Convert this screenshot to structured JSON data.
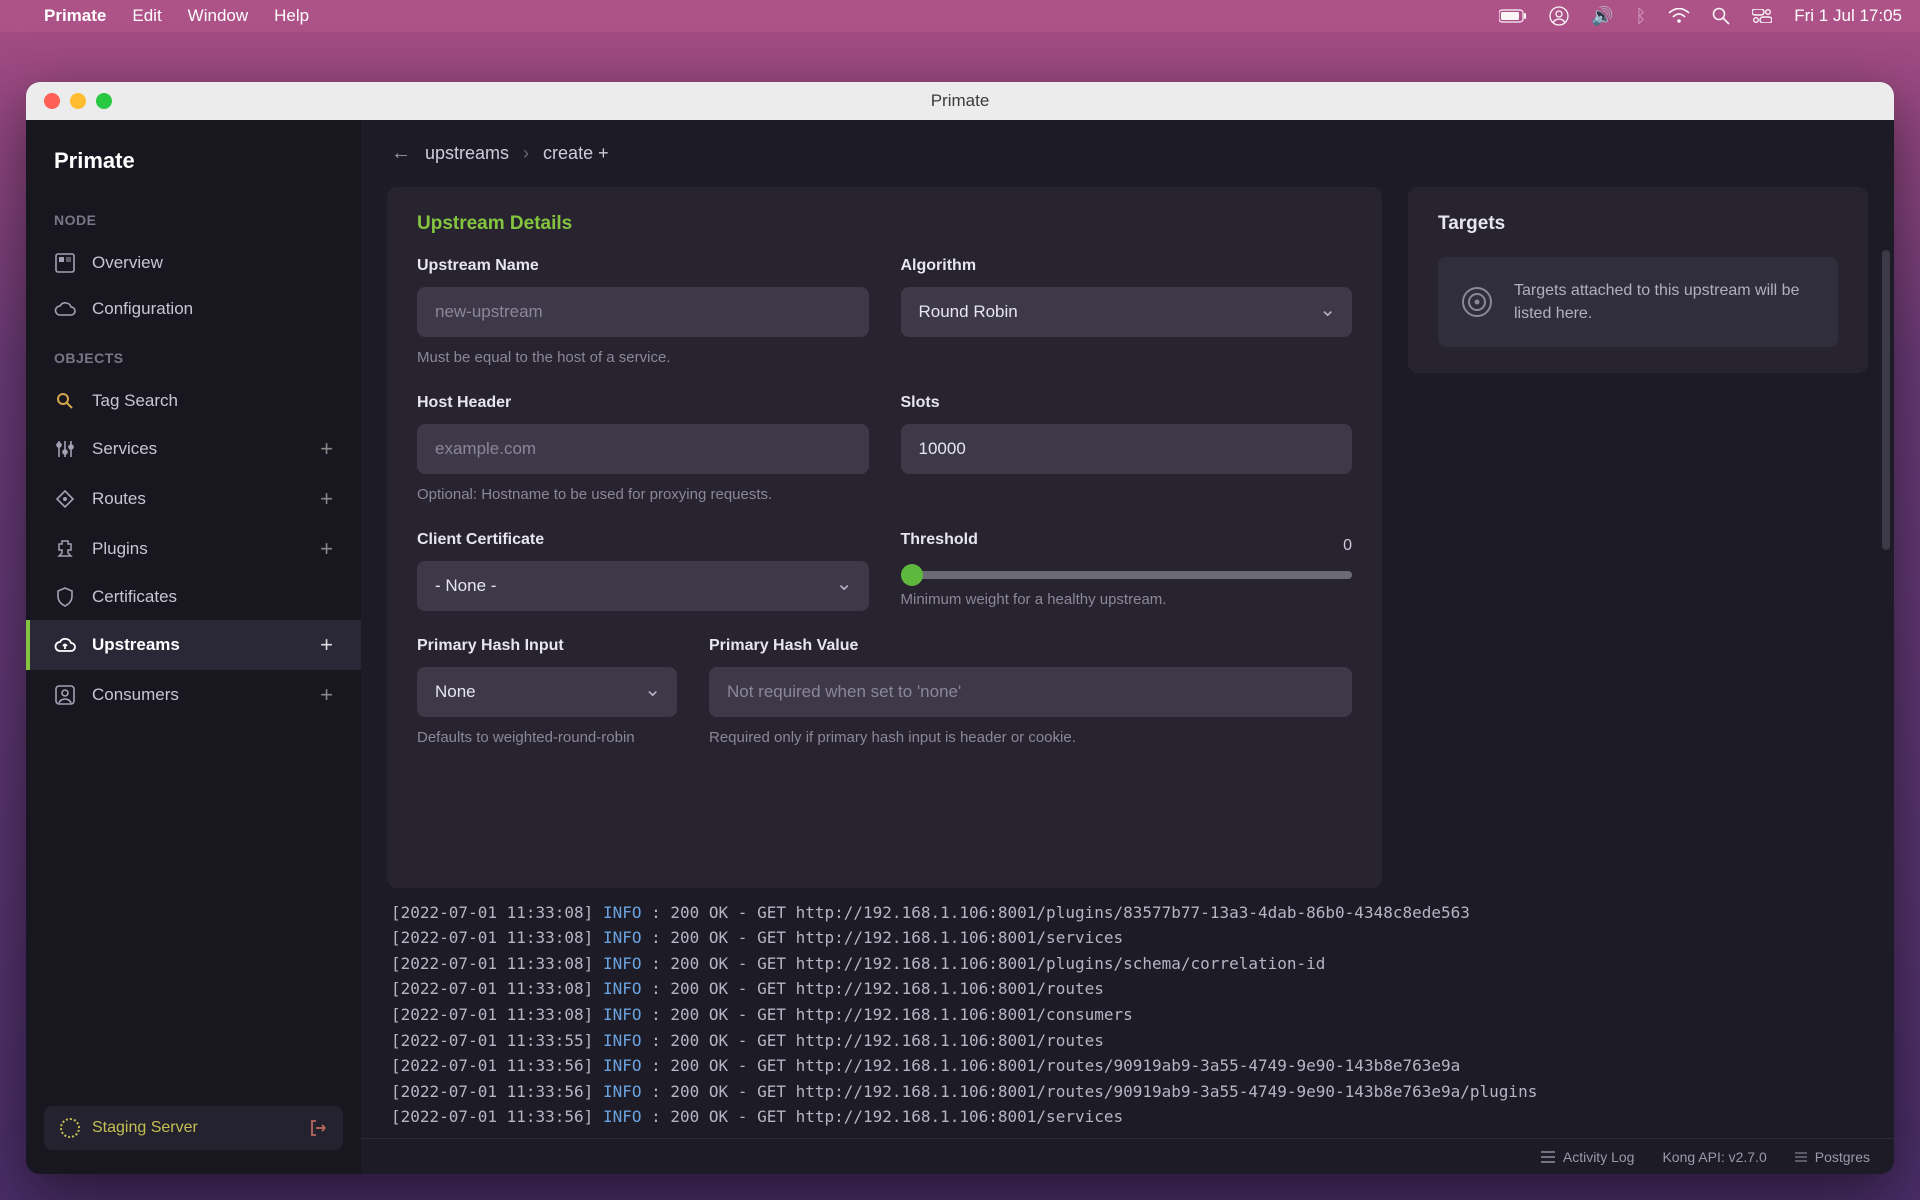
{
  "menubar": {
    "app": "Primate",
    "items": [
      "Edit",
      "Window",
      "Help"
    ],
    "clock": "Fri 1 Jul  17:05"
  },
  "window": {
    "title": "Primate"
  },
  "sidebar": {
    "title": "Primate",
    "sections": {
      "node": "NODE",
      "objects": "OBJECTS"
    },
    "node_items": [
      {
        "label": "Overview"
      },
      {
        "label": "Configuration"
      }
    ],
    "object_items": [
      {
        "label": "Tag Search",
        "plus": false
      },
      {
        "label": "Services",
        "plus": true
      },
      {
        "label": "Routes",
        "plus": true
      },
      {
        "label": "Plugins",
        "plus": true
      },
      {
        "label": "Certificates",
        "plus": false
      },
      {
        "label": "Upstreams",
        "plus": true,
        "active": true
      },
      {
        "label": "Consumers",
        "plus": true
      }
    ],
    "server": "Staging Server"
  },
  "breadcrumb": {
    "root": "upstreams",
    "leaf": "create +"
  },
  "form": {
    "title": "Upstream Details",
    "upstream_name": {
      "label": "Upstream Name",
      "placeholder": "new-upstream",
      "help": "Must be equal to the host of a service."
    },
    "algorithm": {
      "label": "Algorithm",
      "value": "Round Robin"
    },
    "host_header": {
      "label": "Host Header",
      "placeholder": "example.com",
      "help": "Optional: Hostname to be used for proxying requests."
    },
    "slots": {
      "label": "Slots",
      "value": "10000"
    },
    "client_cert": {
      "label": "Client Certificate",
      "value": "- None -"
    },
    "threshold": {
      "label": "Threshold",
      "value": "0",
      "help": "Minimum weight for a healthy upstream."
    },
    "primary_hash_input": {
      "label": "Primary Hash Input",
      "value": "None",
      "help": "Defaults to weighted-round-robin"
    },
    "primary_hash_value": {
      "label": "Primary Hash Value",
      "placeholder": "Not required when set to 'none'",
      "help": "Required only if primary hash input is header or cookie."
    }
  },
  "targets": {
    "title": "Targets",
    "empty": "Targets attached to this upstream will be listed here."
  },
  "log": [
    {
      "ts": "[2022-07-01 11:33:08]",
      "lvl": "INFO",
      "msg": ": 200 OK - GET http://192.168.1.106:8001/plugins/83577b77-13a3-4dab-86b0-4348c8ede563"
    },
    {
      "ts": "[2022-07-01 11:33:08]",
      "lvl": "INFO",
      "msg": ": 200 OK - GET http://192.168.1.106:8001/services"
    },
    {
      "ts": "[2022-07-01 11:33:08]",
      "lvl": "INFO",
      "msg": ": 200 OK - GET http://192.168.1.106:8001/plugins/schema/correlation-id"
    },
    {
      "ts": "[2022-07-01 11:33:08]",
      "lvl": "INFO",
      "msg": ": 200 OK - GET http://192.168.1.106:8001/routes"
    },
    {
      "ts": "[2022-07-01 11:33:08]",
      "lvl": "INFO",
      "msg": ": 200 OK - GET http://192.168.1.106:8001/consumers"
    },
    {
      "ts": "[2022-07-01 11:33:55]",
      "lvl": "INFO",
      "msg": ": 200 OK - GET http://192.168.1.106:8001/routes"
    },
    {
      "ts": "[2022-07-01 11:33:56]",
      "lvl": "INFO",
      "msg": ": 200 OK - GET http://192.168.1.106:8001/routes/90919ab9-3a55-4749-9e90-143b8e763e9a"
    },
    {
      "ts": "[2022-07-01 11:33:56]",
      "lvl": "INFO",
      "msg": ": 200 OK - GET http://192.168.1.106:8001/routes/90919ab9-3a55-4749-9e90-143b8e763e9a/plugins"
    },
    {
      "ts": "[2022-07-01 11:33:56]",
      "lvl": "INFO",
      "msg": ": 200 OK - GET http://192.168.1.106:8001/services"
    }
  ],
  "statusbar": {
    "activity": "Activity Log",
    "api": "Kong API: v2.7.0",
    "db": "Postgres"
  }
}
